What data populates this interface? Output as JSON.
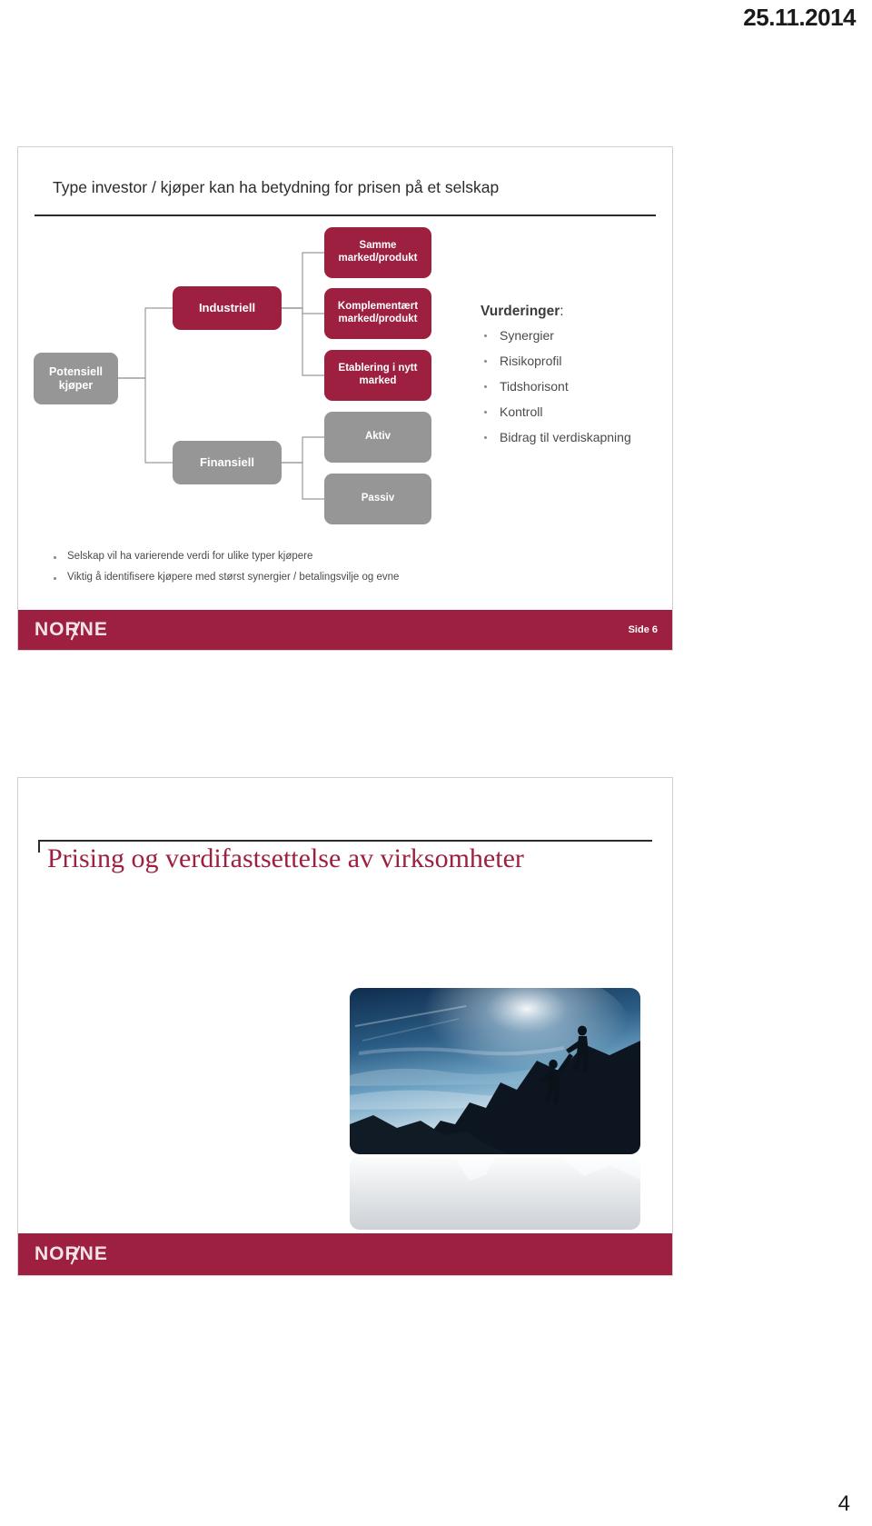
{
  "document": {
    "date": "25.11.2014",
    "page_number": "4"
  },
  "slide1": {
    "title": "Type investor / kjøper kan ha betydning for prisen på et selskap",
    "diagram": {
      "root": "Potensiell kjøper",
      "branches": [
        {
          "label": "Industriell",
          "color": "#9d2040"
        },
        {
          "label": "Finansiell",
          "color": "#969696"
        }
      ],
      "leaves": [
        {
          "label": "Samme marked/produkt",
          "color": "#9d2040"
        },
        {
          "label": "Komplementært marked/produkt",
          "color": "#9d2040"
        },
        {
          "label": "Etablering i nytt marked",
          "color": "#9d2040"
        },
        {
          "label": "Aktiv",
          "color": "#969696"
        },
        {
          "label": "Passiv",
          "color": "#969696"
        }
      ]
    },
    "evaluation": {
      "heading_bold": "Vurderinger",
      "heading_suffix": ":",
      "items": [
        "Synergier",
        "Risikoprofil",
        "Tidshorisont",
        "Kontroll",
        "Bidrag til verdiskapning"
      ]
    },
    "bullets": [
      "Selskap vil ha varierende verdi for ulike typer kjøpere",
      "Viktig å identifisere kjøpere med størst synergier / betalingsvilje og evne"
    ],
    "footer": {
      "logo": "NORNE",
      "side_label": "Side 6"
    }
  },
  "slide2": {
    "title": "Prising og verdifastsettelse av virksomheter",
    "photo_alt": "climber-helping-hand-photo",
    "footer": {
      "logo": "NORNE"
    }
  },
  "colors": {
    "brand_maroon": "#9d2040",
    "node_gray": "#969696",
    "text_dark": "#2b2b2b",
    "connector": "#9a9a9a"
  }
}
